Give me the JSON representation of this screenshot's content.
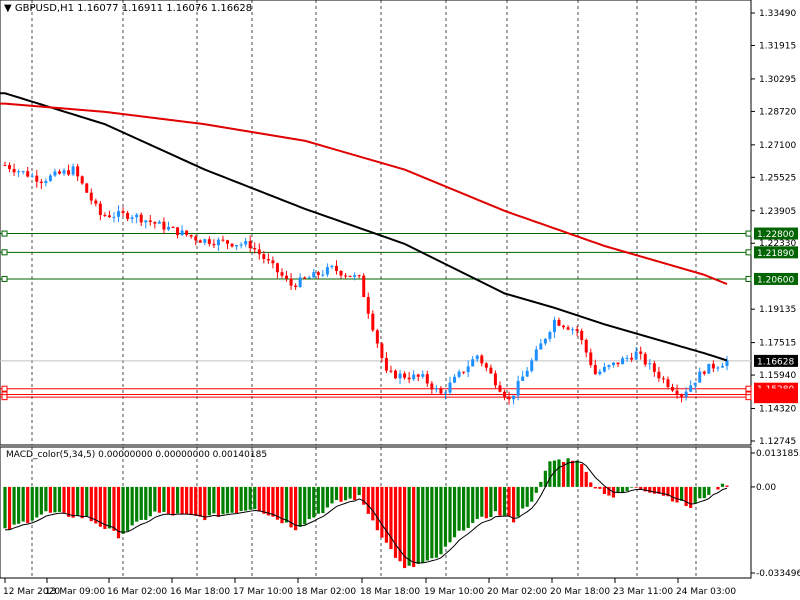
{
  "header": {
    "symbol": "GBPUSD,H1",
    "open": "1.16077",
    "high": "1.16911",
    "low": "1.16076",
    "close": "1.16628"
  },
  "price_axis": {
    "ticks": [
      "1.33490",
      "1.31915",
      "1.30295",
      "1.28720",
      "1.27100",
      "1.25525",
      "1.23905",
      "1.22330",
      "1.19135",
      "1.17515",
      "1.15940",
      "1.14320",
      "1.12745"
    ],
    "range": [
      1.12745,
      1.3349
    ]
  },
  "levels": {
    "green": [
      {
        "label": "1.22800",
        "price": 1.228
      },
      {
        "label": "1.21890",
        "price": 1.2189
      },
      {
        "label": "1.20600",
        "price": 1.206
      }
    ],
    "red": [
      {
        "label": "1.15280",
        "price": 1.1528
      },
      {
        "label": "1.14900",
        "price": 1.15
      },
      {
        "label": "",
        "price": 1.1487
      }
    ],
    "current": {
      "label": "1.16628",
      "price": 1.16628
    }
  },
  "macd": {
    "label": "MACD_color(5,34,5) 0.00000000 0.00000000 0.00140185",
    "top": "0.0131853",
    "zero": "0.00",
    "bottom": "-0.033496",
    "range": [
      -0.033496,
      0.0131853
    ]
  },
  "time_axis": [
    "12 Mar 2020",
    "13 Mar 09:00",
    "16 Mar 02:00",
    "16 Mar 18:00",
    "17 Mar 10:00",
    "18 Mar 02:00",
    "18 Mar 18:00",
    "19 Mar 10:00",
    "20 Mar 02:00",
    "20 Mar 18:00",
    "23 Mar 11:00",
    "24 Mar 03:00"
  ],
  "colors": {
    "bull": "#1e90ff",
    "bear": "#ff0000",
    "ma_fast": "#000000",
    "ma_slow": "#e00000",
    "green_level": "#006400",
    "macd_up": "#008000",
    "macd_down": "#ff0000"
  },
  "chart_data": {
    "type": "candlestick",
    "bars": 160,
    "price_path": [
      [
        0,
        1.2612
      ],
      [
        8,
        1.254
      ],
      [
        15,
        1.259
      ],
      [
        21,
        1.237
      ],
      [
        28,
        1.237
      ],
      [
        37,
        1.2297
      ],
      [
        43,
        1.225
      ],
      [
        54,
        1.2225
      ],
      [
        63,
        1.203
      ],
      [
        72,
        1.211
      ],
      [
        78,
        1.206
      ],
      [
        84,
        1.16
      ],
      [
        92,
        1.158
      ],
      [
        96,
        1.15
      ],
      [
        104,
        1.169
      ],
      [
        111,
        1.147
      ],
      [
        116,
        1.166
      ],
      [
        121,
        1.186
      ],
      [
        126,
        1.181
      ],
      [
        130,
        1.16
      ],
      [
        139,
        1.17
      ],
      [
        145,
        1.157
      ],
      [
        149,
        1.15
      ],
      [
        154,
        1.162
      ],
      [
        159,
        1.1663
      ]
    ],
    "ma_fast": [
      [
        0,
        1.296
      ],
      [
        22,
        1.281
      ],
      [
        44,
        1.259
      ],
      [
        66,
        1.24
      ],
      [
        88,
        1.223
      ],
      [
        110,
        1.199
      ],
      [
        121,
        1.192
      ],
      [
        132,
        1.184
      ],
      [
        154,
        1.17
      ],
      [
        159,
        1.1665
      ]
    ],
    "ma_slow": [
      [
        0,
        1.291
      ],
      [
        22,
        1.287
      ],
      [
        44,
        1.281
      ],
      [
        66,
        1.273
      ],
      [
        88,
        1.259
      ],
      [
        110,
        1.239
      ],
      [
        132,
        1.222
      ],
      [
        154,
        1.208
      ],
      [
        159,
        1.2035
      ]
    ],
    "macd_hist": [
      [
        0,
        -0.017
      ],
      [
        9,
        -0.01
      ],
      [
        18,
        -0.012
      ],
      [
        25,
        -0.019
      ],
      [
        33,
        -0.01
      ],
      [
        44,
        -0.012
      ],
      [
        55,
        -0.008
      ],
      [
        64,
        -0.016
      ],
      [
        73,
        -0.006
      ],
      [
        78,
        -0.004
      ],
      [
        84,
        -0.022
      ],
      [
        88,
        -0.032
      ],
      [
        95,
        -0.028
      ],
      [
        101,
        -0.016
      ],
      [
        108,
        -0.01
      ],
      [
        112,
        -0.013
      ],
      [
        117,
        -0.003
      ],
      [
        120,
        0.01
      ],
      [
        126,
        0.011
      ],
      [
        130,
        0.0
      ],
      [
        134,
        -0.004
      ],
      [
        139,
        0.0
      ],
      [
        145,
        -0.003
      ],
      [
        151,
        -0.008
      ],
      [
        156,
        -0.001
      ],
      [
        159,
        0.0014
      ]
    ]
  }
}
